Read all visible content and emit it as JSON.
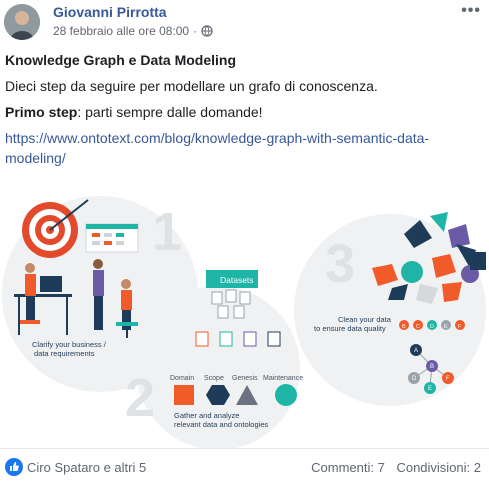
{
  "post": {
    "author": "Giovanni Pirrotta",
    "timestamp": "28 febbraio alle ore 08:00",
    "more_icon": "ellipsis-icon",
    "title": "Knowledge Graph e Data Modeling",
    "line1": "Dieci step da seguire per modellare un grafo di conoscenza.",
    "step_bold": "Primo step",
    "step_rest": ": parti sempre dalle domande!",
    "link": "https://www.ontotext.com/blog/knowledge-graph-with-semantic-data-modeling/"
  },
  "image": {
    "step1_number": "1",
    "step1_caption_1": "Clarify your business /",
    "step1_caption_2": "data requirements",
    "step2_number": "2",
    "step2_datasets": "Datasets",
    "step2_tags": [
      "Domain",
      "Scope",
      "Genesis",
      "Maintenance"
    ],
    "step2_caption_1": "Gather and analyze",
    "step2_caption_2": "relevant data and ontologies",
    "step3_number": "3",
    "step3_caption_1": "Clean your data",
    "step3_caption_2": "to ensure data quality",
    "step3_node_letters": [
      "B",
      "C",
      "D",
      "E",
      "F"
    ],
    "step3_tree_letters": [
      "A",
      "B",
      "D",
      "E",
      "F"
    ],
    "colors": {
      "orange": "#f15a29",
      "teal": "#1fb5a6",
      "navy": "#1f3b5a",
      "gray": "#d6d9dc",
      "purple": "#6b5aa8"
    }
  },
  "footer": {
    "like_icon": "like-icon",
    "likes": "Ciro Spataro e altri 5",
    "comments": "Commenti: 7",
    "shares": "Condivisioni: 2"
  }
}
